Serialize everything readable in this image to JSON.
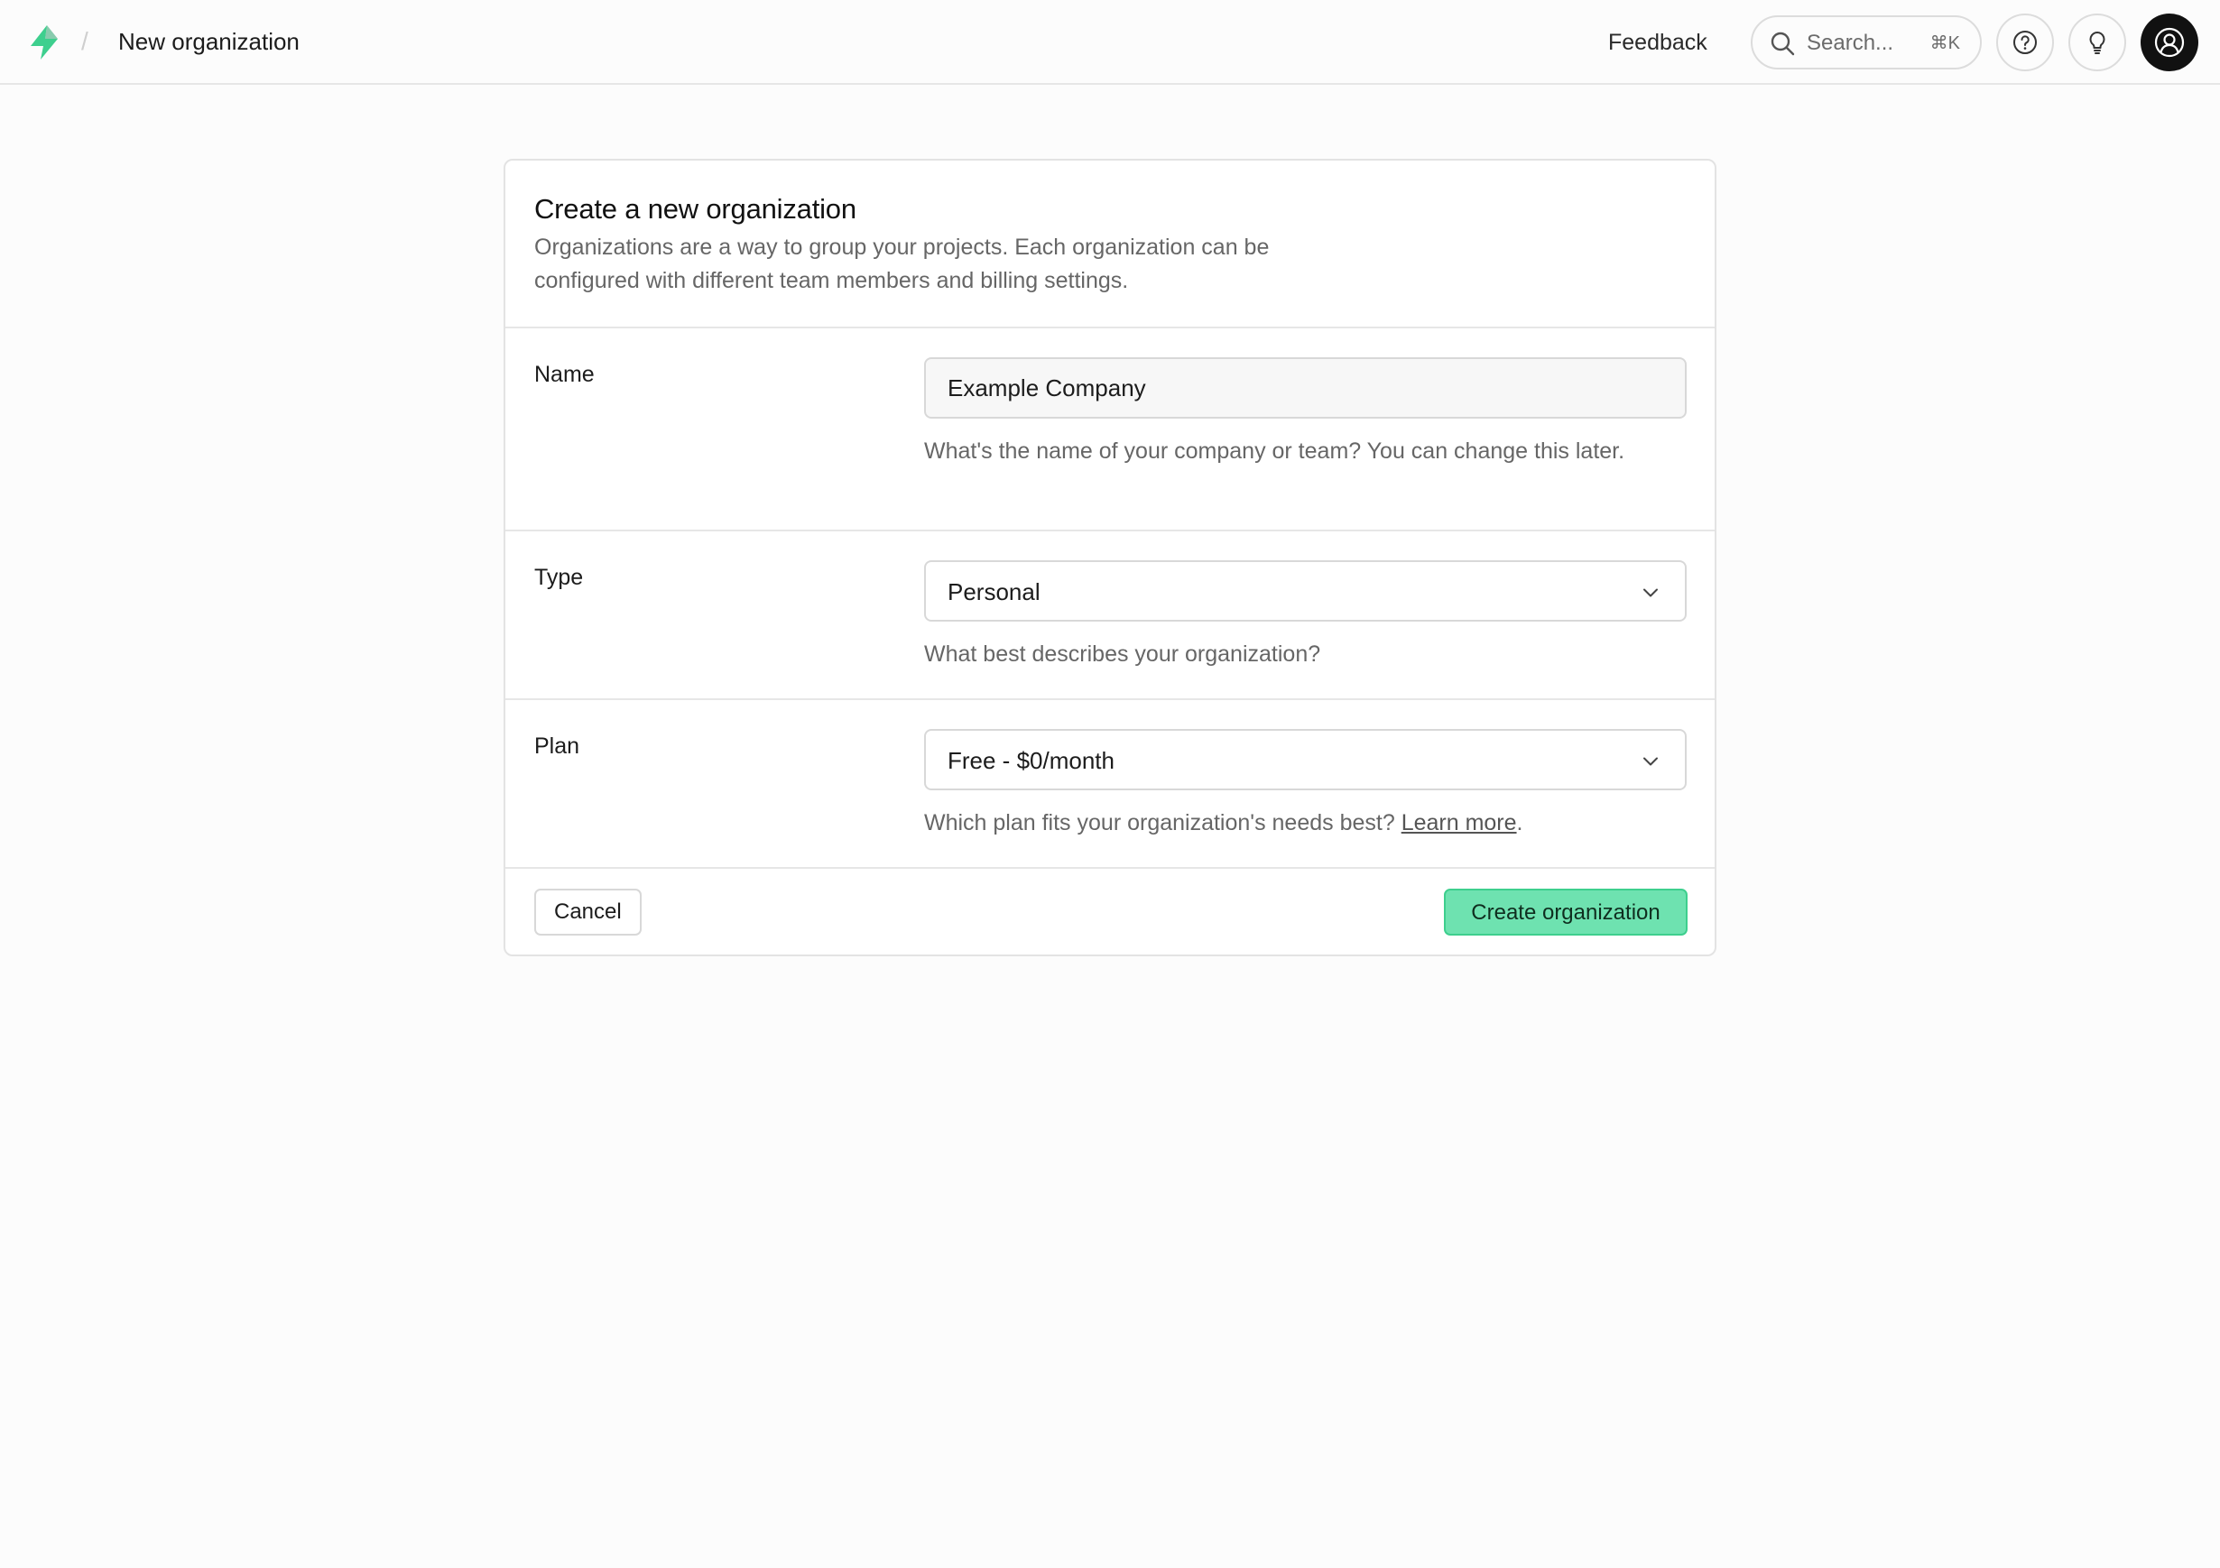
{
  "header": {
    "logo_icon": "supabase-bolt-icon",
    "breadcrumb_separator": "/",
    "breadcrumb_current": "New organization",
    "feedback_label": "Feedback",
    "search": {
      "placeholder": "Search...",
      "shortcut": "⌘K",
      "icon": "search-icon"
    },
    "help_icon": "help-circle-icon",
    "tips_icon": "lightbulb-icon",
    "avatar_icon": "user-avatar-icon"
  },
  "card": {
    "title": "Create a new organization",
    "description": "Organizations are a way to group your projects. Each organization can be configured with different team members and billing settings.",
    "fields": {
      "name": {
        "label": "Name",
        "value": "Example Company",
        "help": "What's the name of your company or team? You can change this later."
      },
      "type": {
        "label": "Type",
        "selected": "Personal",
        "help": "What best describes your organization?"
      },
      "plan": {
        "label": "Plan",
        "selected": "Free - $0/month",
        "help_prefix": "Which plan fits your organization's needs best? ",
        "help_link": "Learn more",
        "help_suffix": "."
      }
    },
    "cancel_label": "Cancel",
    "submit_label": "Create organization"
  },
  "colors": {
    "brand": "#3ecf8e",
    "primary_button_bg": "#6ee2b0",
    "page_bg": "#fcfcfc",
    "card_bg": "#ffffff"
  }
}
